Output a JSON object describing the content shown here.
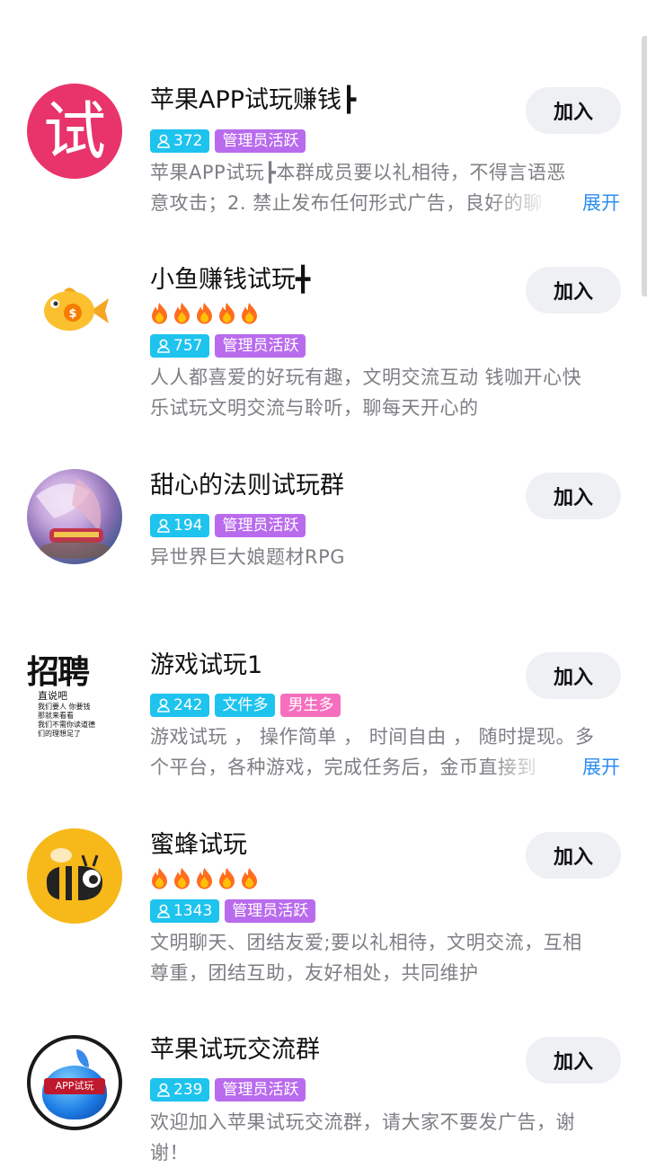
{
  "join_label": "加入",
  "expand_label": "展开",
  "groups": [
    {
      "name": "苹果APP试玩赚钱┣",
      "avatar": "试",
      "flames": 0,
      "tags": [
        {
          "type": "member",
          "text": "372"
        },
        {
          "type": "admin",
          "text": "管理员活跃"
        }
      ],
      "desc": [
        "苹果APP试玩┣本群成员要以礼相待，不得言语恶",
        "意攻击；2. 禁止发布任何形式广告，良好的聊"
      ],
      "expandable": true
    },
    {
      "name": "小鱼赚钱试玩╋",
      "avatar": "fish-icon",
      "flames": 5,
      "tags": [
        {
          "type": "member",
          "text": "757"
        },
        {
          "type": "admin",
          "text": "管理员活跃"
        }
      ],
      "desc": [
        "人人都喜爱的好玩有趣，文明交流互动 钱咖开心快",
        "乐试玩文明交流与聆听，聊每天开心的"
      ],
      "expandable": false
    },
    {
      "name": "甜心的法则试玩群",
      "avatar": "anime-art",
      "flames": 0,
      "tags": [
        {
          "type": "member",
          "text": "194"
        },
        {
          "type": "admin",
          "text": "管理员活跃"
        }
      ],
      "desc": [
        "异世界巨大娘题材RPG"
      ],
      "expandable": false
    },
    {
      "name": "游戏试玩1",
      "avatar": "招聘",
      "avatar_sub": [
        "直说吧",
        "我们要人 你要钱",
        "那就来看看",
        "我们不需你读道德",
        "们的理想足了"
      ],
      "flames": 0,
      "tags": [
        {
          "type": "member",
          "text": "242"
        },
        {
          "type": "files",
          "text": "文件多"
        },
        {
          "type": "male",
          "text": "男生多"
        }
      ],
      "desc": [
        "游戏试玩 ， 操作简单 ， 时间自由 ， 随时提现。多",
        "个平台，各种游戏，完成任务后，金币直接到"
      ],
      "expandable": true
    },
    {
      "name": "蜜蜂试玩",
      "avatar": "bee-icon",
      "flames": 5,
      "tags": [
        {
          "type": "member",
          "text": "1343"
        },
        {
          "type": "admin",
          "text": "管理员活跃"
        }
      ],
      "desc": [
        "文明聊天、团结友爱;要以礼相待，文明交流，互相",
        "尊重，团结互助，友好相处，共同维护"
      ],
      "expandable": false
    },
    {
      "name": "苹果试玩交流群",
      "avatar": "APP试玩",
      "flames": 0,
      "tags": [
        {
          "type": "member",
          "text": "239"
        },
        {
          "type": "admin",
          "text": "管理员活跃"
        }
      ],
      "desc": [
        "欢迎加入苹果试玩交流群，请大家不要发广告，谢",
        "谢！"
      ],
      "expandable": false
    }
  ]
}
